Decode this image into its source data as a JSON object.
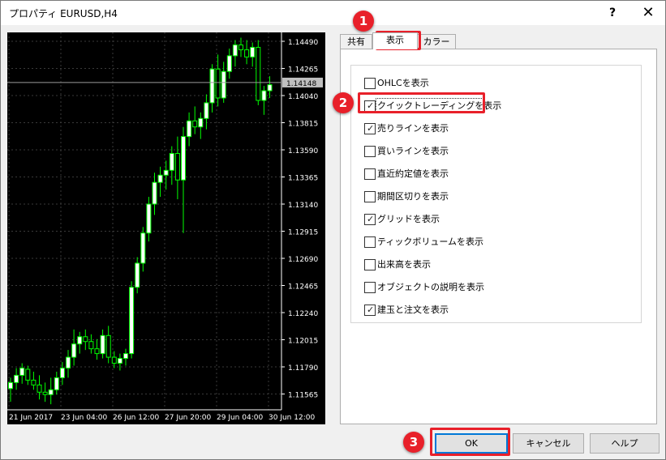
{
  "window": {
    "title": "プロパティ EURUSD,H4",
    "help_label": "?",
    "close_label": "✕"
  },
  "chart": {
    "symbol": "EURUSD",
    "timeframe": "H4",
    "price_labels": [
      "1.14490",
      "1.14265",
      "1.14040",
      "1.13815",
      "1.13590",
      "1.13365",
      "1.13140",
      "1.12915",
      "1.12690",
      "1.12465",
      "1.12240",
      "1.12015",
      "1.11790",
      "1.11565"
    ],
    "current_price": "1.14148",
    "time_labels": [
      "21 Jun 2017",
      "23 Jun 04:00",
      "26 Jun 12:00",
      "27 Jun 20:00",
      "29 Jun 04:00",
      "30 Jun 12:00"
    ],
    "colors": {
      "background": "#000000",
      "bull_body": "#ffffff",
      "bear_body": "#000000",
      "wick": "#00ff00",
      "grid": "#3a3a3a",
      "axis_text": "#ffffff",
      "current_price_label_bg": "#c0c0c0"
    }
  },
  "tabs": [
    {
      "label": "共有"
    },
    {
      "label": "表示",
      "active": true
    },
    {
      "label": "カラー"
    }
  ],
  "display_options": [
    {
      "label": "OHLCを表示",
      "checked": false
    },
    {
      "label": "クイックトレーディングを表示",
      "checked": true,
      "focused": true
    },
    {
      "label": "売りラインを表示",
      "checked": true
    },
    {
      "label": "買いラインを表示",
      "checked": false
    },
    {
      "label": "直近約定値を表示",
      "checked": false
    },
    {
      "label": "期間区切りを表示",
      "checked": false
    },
    {
      "label": "グリッドを表示",
      "checked": true
    },
    {
      "label": "ティックボリュームを表示",
      "checked": false
    },
    {
      "label": "出来高を表示",
      "checked": false
    },
    {
      "label": "オブジェクトの説明を表示",
      "checked": false
    },
    {
      "label": "建玉と注文を表示",
      "checked": true
    }
  ],
  "buttons": {
    "ok": "OK",
    "cancel": "キャンセル",
    "help": "ヘルプ"
  },
  "annotations": [
    "1",
    "2",
    "3"
  ],
  "accent": "#e8202a",
  "candles": [
    {
      "o": 1.1161,
      "h": 1.117,
      "l": 1.115,
      "c": 1.1166
    },
    {
      "o": 1.1166,
      "h": 1.1178,
      "l": 1.116,
      "c": 1.1172
    },
    {
      "o": 1.1172,
      "h": 1.1182,
      "l": 1.1165,
      "c": 1.1178
    },
    {
      "o": 1.1177,
      "h": 1.118,
      "l": 1.1164,
      "c": 1.1168
    },
    {
      "o": 1.1168,
      "h": 1.1175,
      "l": 1.116,
      "c": 1.1164
    },
    {
      "o": 1.1164,
      "h": 1.1172,
      "l": 1.1152,
      "c": 1.1158
    },
    {
      "o": 1.1158,
      "h": 1.1166,
      "l": 1.115,
      "c": 1.1156
    },
    {
      "o": 1.1156,
      "h": 1.117,
      "l": 1.1148,
      "c": 1.116
    },
    {
      "o": 1.116,
      "h": 1.1175,
      "l": 1.1156,
      "c": 1.117
    },
    {
      "o": 1.117,
      "h": 1.1183,
      "l": 1.1164,
      "c": 1.1178
    },
    {
      "o": 1.1178,
      "h": 1.1193,
      "l": 1.117,
      "c": 1.1187
    },
    {
      "o": 1.1187,
      "h": 1.121,
      "l": 1.118,
      "c": 1.1198
    },
    {
      "o": 1.1198,
      "h": 1.1208,
      "l": 1.119,
      "c": 1.1204
    },
    {
      "o": 1.1204,
      "h": 1.121,
      "l": 1.1193,
      "c": 1.12
    },
    {
      "o": 1.12,
      "h": 1.1206,
      "l": 1.119,
      "c": 1.1194
    },
    {
      "o": 1.1194,
      "h": 1.1202,
      "l": 1.1185,
      "c": 1.119
    },
    {
      "o": 1.119,
      "h": 1.121,
      "l": 1.1186,
      "c": 1.1205
    },
    {
      "o": 1.1205,
      "h": 1.1213,
      "l": 1.1182,
      "c": 1.1187
    },
    {
      "o": 1.1187,
      "h": 1.1192,
      "l": 1.1178,
      "c": 1.1182
    },
    {
      "o": 1.1182,
      "h": 1.119,
      "l": 1.1176,
      "c": 1.1186
    },
    {
      "o": 1.1186,
      "h": 1.1194,
      "l": 1.118,
      "c": 1.119
    },
    {
      "o": 1.119,
      "h": 1.125,
      "l": 1.1186,
      "c": 1.1245
    },
    {
      "o": 1.1245,
      "h": 1.127,
      "l": 1.124,
      "c": 1.1265
    },
    {
      "o": 1.1265,
      "h": 1.1295,
      "l": 1.1258,
      "c": 1.129
    },
    {
      "o": 1.129,
      "h": 1.132,
      "l": 1.1283,
      "c": 1.1314
    },
    {
      "o": 1.1314,
      "h": 1.134,
      "l": 1.1305,
      "c": 1.1332
    },
    {
      "o": 1.1332,
      "h": 1.1345,
      "l": 1.132,
      "c": 1.1338
    },
    {
      "o": 1.1338,
      "h": 1.135,
      "l": 1.1326,
      "c": 1.1342
    },
    {
      "o": 1.1342,
      "h": 1.1362,
      "l": 1.133,
      "c": 1.1356
    },
    {
      "o": 1.1356,
      "h": 1.137,
      "l": 1.1318,
      "c": 1.1334
    },
    {
      "o": 1.1334,
      "h": 1.1378,
      "l": 1.129,
      "c": 1.137
    },
    {
      "o": 1.137,
      "h": 1.139,
      "l": 1.1362,
      "c": 1.1383
    },
    {
      "o": 1.1383,
      "h": 1.1395,
      "l": 1.1372,
      "c": 1.1378
    },
    {
      "o": 1.1378,
      "h": 1.139,
      "l": 1.1368,
      "c": 1.1385
    },
    {
      "o": 1.1385,
      "h": 1.1405,
      "l": 1.1376,
      "c": 1.1398
    },
    {
      "o": 1.1398,
      "h": 1.143,
      "l": 1.139,
      "c": 1.1426
    },
    {
      "o": 1.1426,
      "h": 1.1438,
      "l": 1.1395,
      "c": 1.1402
    },
    {
      "o": 1.1402,
      "h": 1.1432,
      "l": 1.1398,
      "c": 1.1424
    },
    {
      "o": 1.1424,
      "h": 1.1443,
      "l": 1.1418,
      "c": 1.1437
    },
    {
      "o": 1.1437,
      "h": 1.145,
      "l": 1.1428,
      "c": 1.1446
    },
    {
      "o": 1.1446,
      "h": 1.1452,
      "l": 1.1436,
      "c": 1.1442
    },
    {
      "o": 1.1442,
      "h": 1.145,
      "l": 1.143,
      "c": 1.1436
    },
    {
      "o": 1.1436,
      "h": 1.1448,
      "l": 1.1428,
      "c": 1.1444
    },
    {
      "o": 1.1444,
      "h": 1.145,
      "l": 1.1396,
      "c": 1.14
    },
    {
      "o": 1.14,
      "h": 1.1412,
      "l": 1.1388,
      "c": 1.1408
    },
    {
      "o": 1.1408,
      "h": 1.142,
      "l": 1.1402,
      "c": 1.1413
    }
  ]
}
